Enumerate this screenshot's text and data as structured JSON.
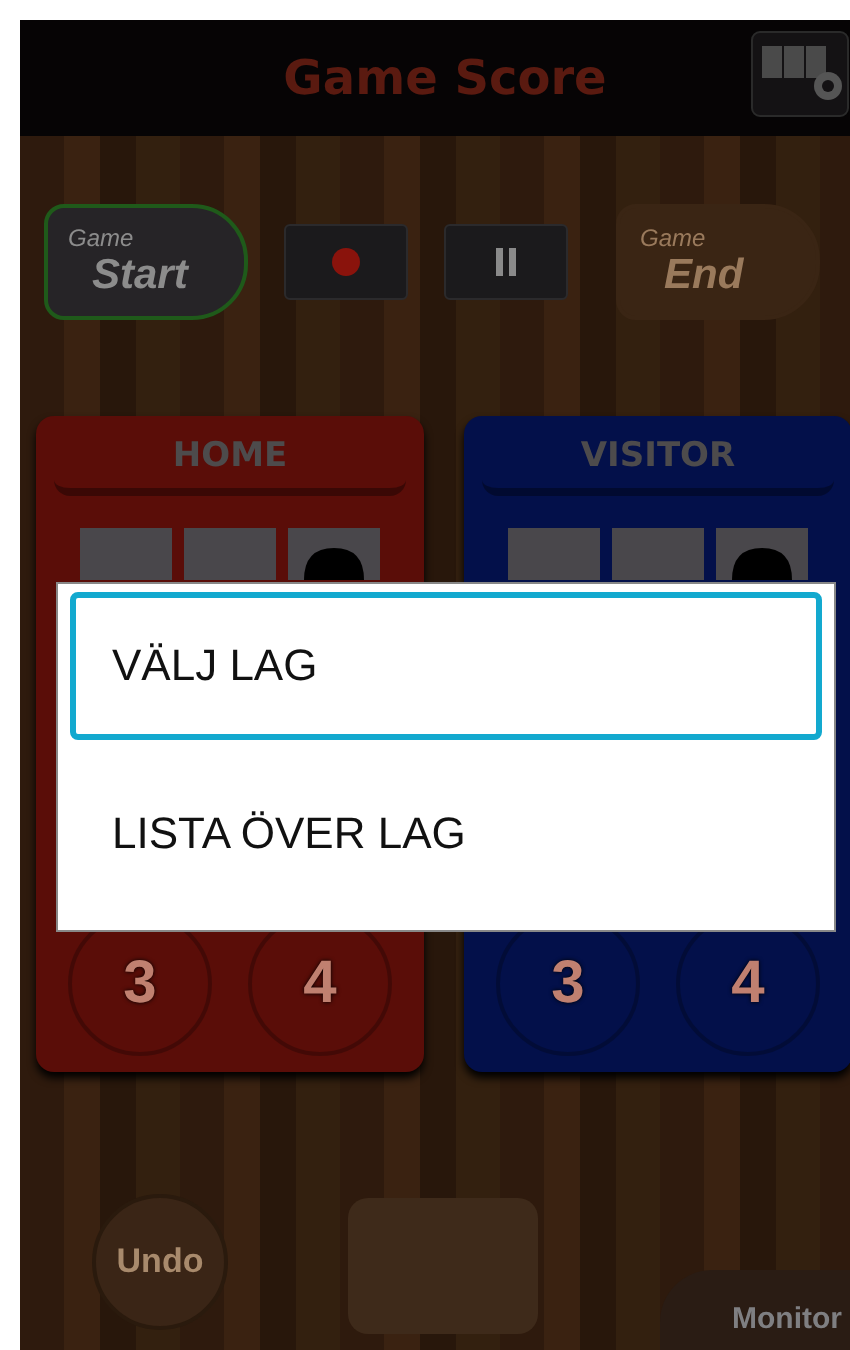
{
  "header": {
    "title": "Game Score"
  },
  "controls": [
    {
      "kind": "start",
      "top": "Game",
      "bottom": "Start",
      "disabled": false
    },
    {
      "kind": "record",
      "disabled": false
    },
    {
      "kind": "pause",
      "disabled": false
    },
    {
      "kind": "end",
      "top": "Game",
      "bottom": "End",
      "disabled": true
    }
  ],
  "teams": [
    {
      "name": "HOME",
      "color": "#5a0d08",
      "buttons": [
        "3",
        "4"
      ]
    },
    {
      "name": "VISITOR",
      "color": "#03104a",
      "buttons": [
        "3",
        "4"
      ]
    }
  ],
  "dialog": {
    "items": [
      {
        "label": "VÄLJ LAG",
        "selected": true
      },
      {
        "label": "LISTA ÖVER LAG",
        "selected": false
      }
    ]
  },
  "bottom": {
    "undo": "Undo",
    "monitor": "Monitor"
  }
}
